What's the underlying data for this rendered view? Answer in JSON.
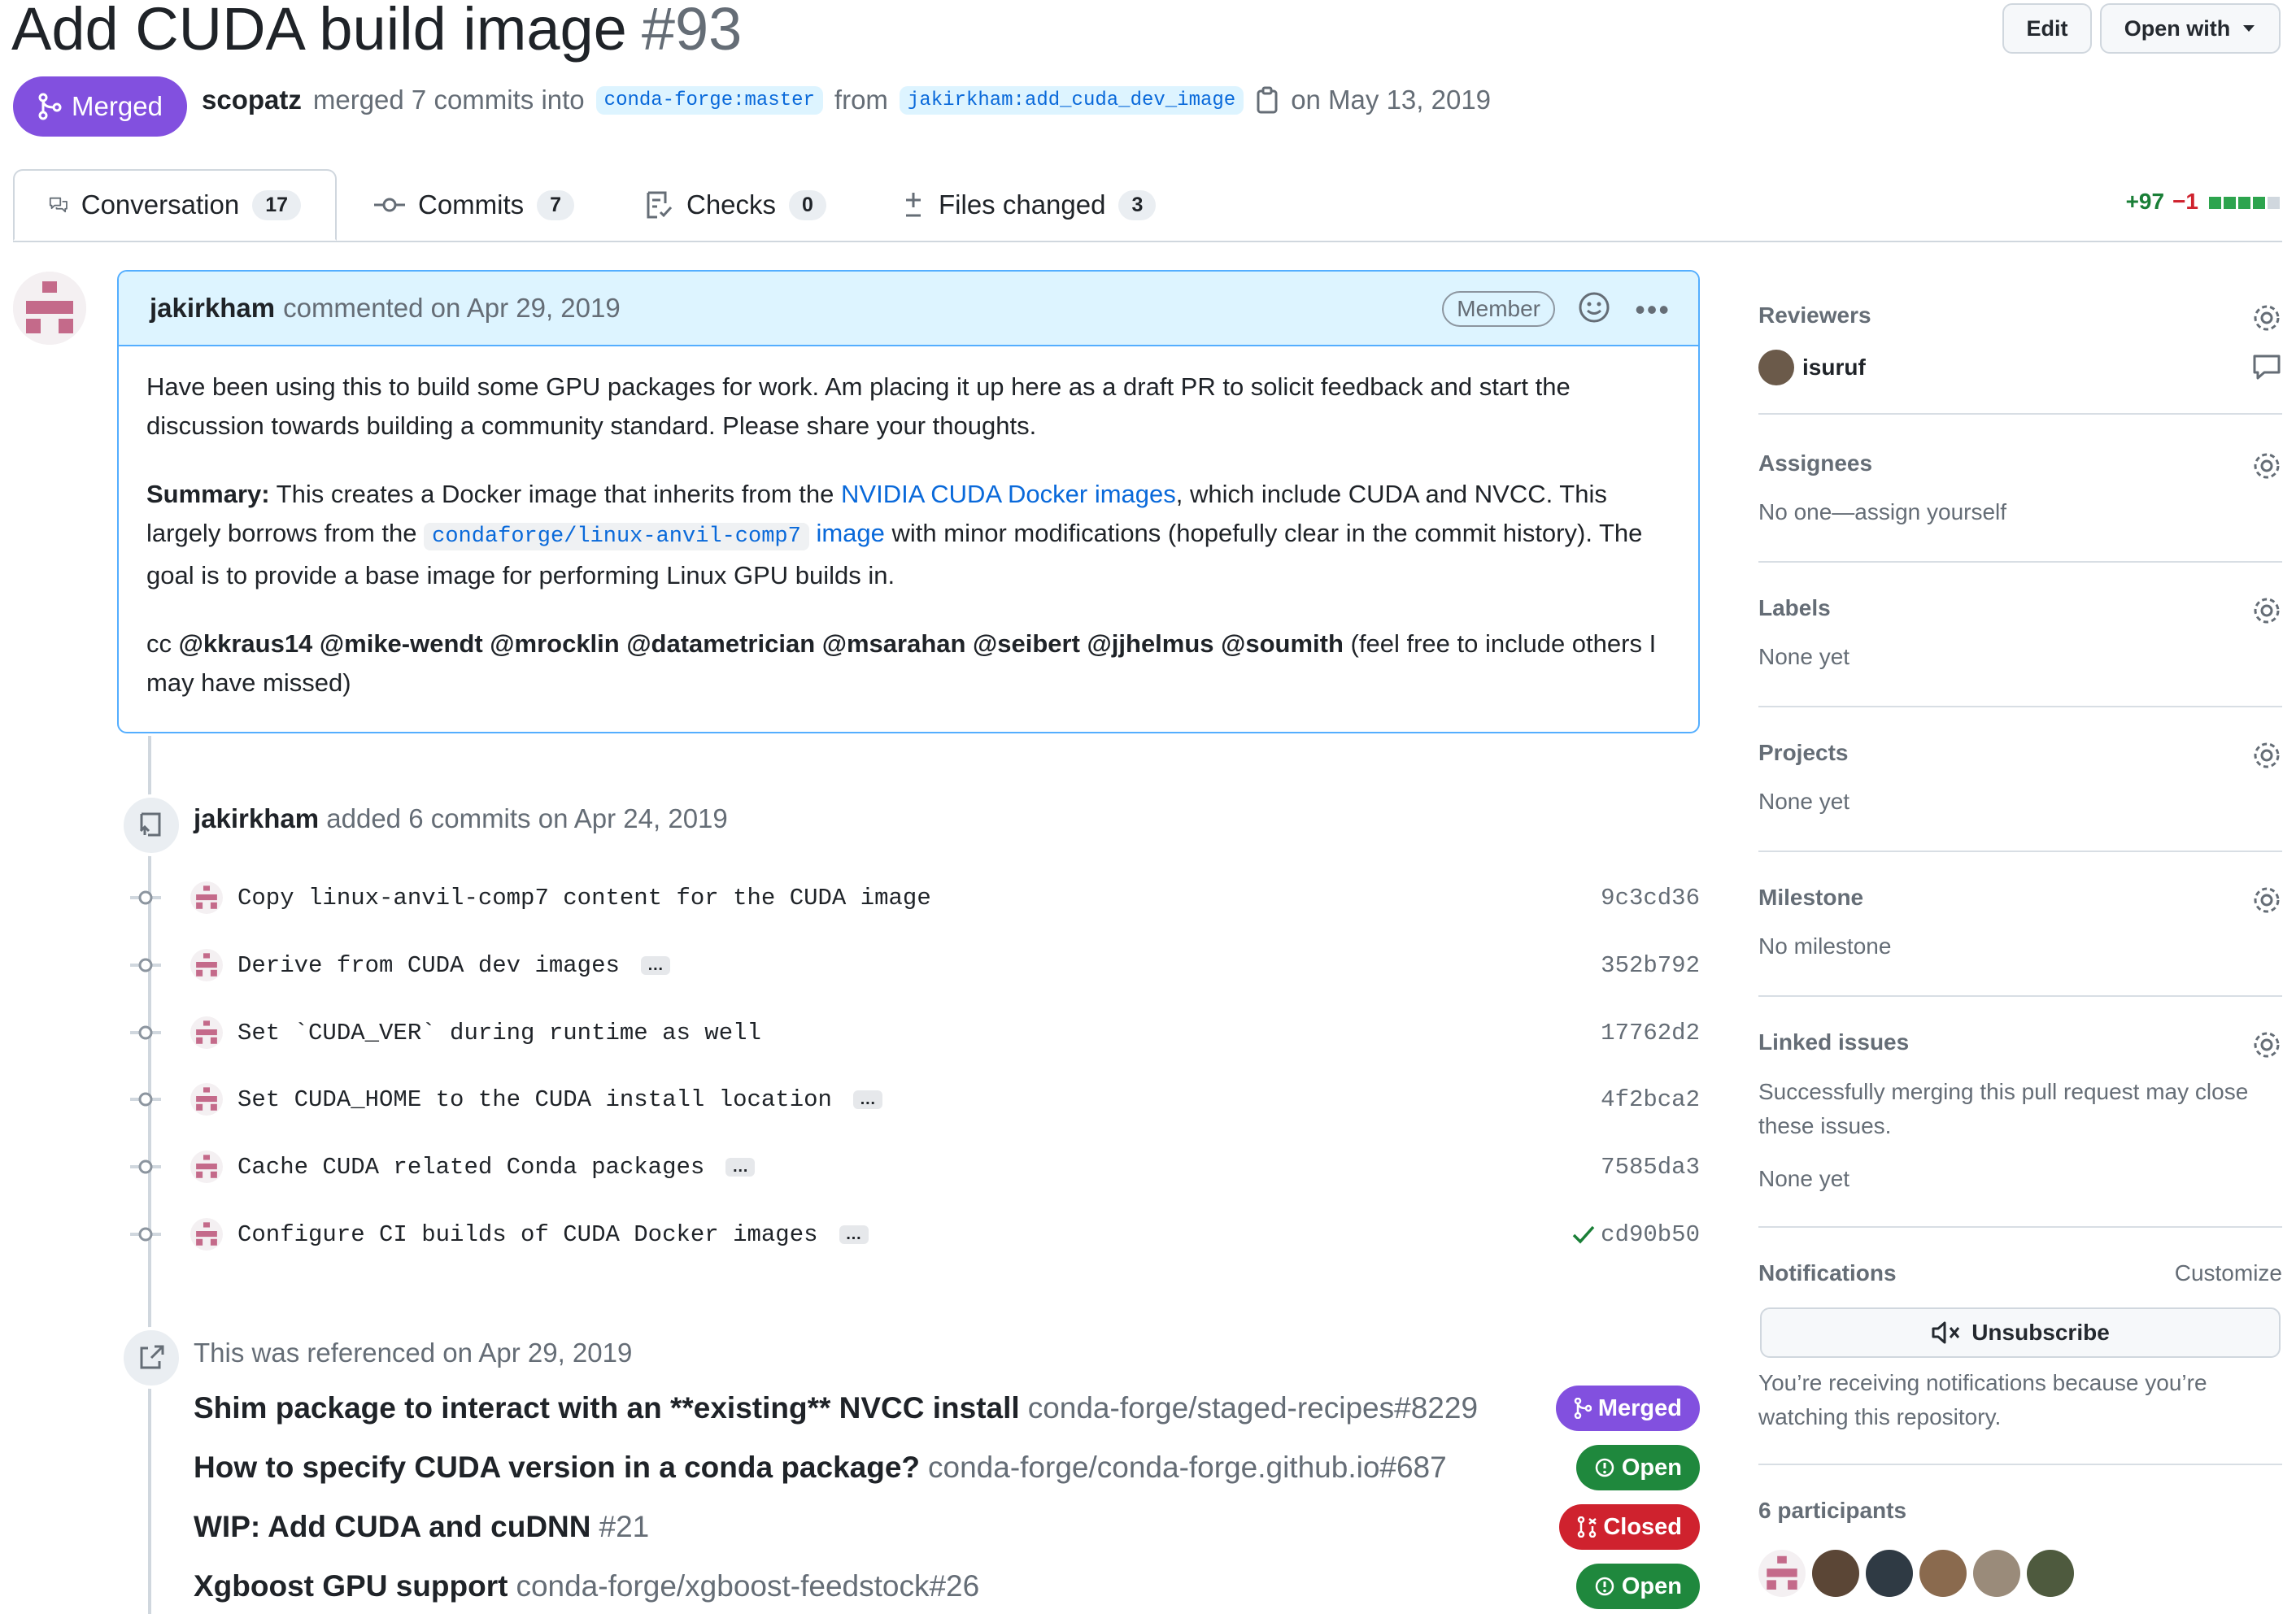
{
  "pr": {
    "title": "Add CUDA build image",
    "number": "#93",
    "state": "Merged",
    "author": "scopatz",
    "merge_text": "merged 7 commits into",
    "base_branch": "conda-forge:master",
    "from_text": "from",
    "head_branch": "jakirkham:add_cuda_dev_image",
    "date_text": "on May 13, 2019"
  },
  "header_buttons": {
    "edit": "Edit",
    "open_with": "Open with"
  },
  "tabs": [
    {
      "label": "Conversation",
      "count": "17"
    },
    {
      "label": "Commits",
      "count": "7"
    },
    {
      "label": "Checks",
      "count": "0"
    },
    {
      "label": "Files changed",
      "count": "3"
    }
  ],
  "diffstat": {
    "additions": "+97",
    "deletions": "−1"
  },
  "comment": {
    "author": "jakirkham",
    "meta": "commented on Apr 29, 2019",
    "badge": "Member",
    "p1": "Have been using this to build some GPU packages for work. Am placing it up here as a draft PR to solicit feedback and start the discussion towards building a community standard. Please share your thoughts.",
    "summary_label": "Summary:",
    "summary_a": "This creates a Docker image that inherits from the",
    "summary_link": "NVIDIA CUDA Docker images",
    "summary_b": ", which include CUDA and NVCC. This largely borrows from the",
    "summary_code": "condaforge/linux-anvil-comp7",
    "summary_link2": "image",
    "summary_c": "with minor modifications (hopefully clear in the commit history). The goal is to provide a base image for performing Linux GPU builds in.",
    "cc_prefix": "cc",
    "cc_mentions": "@kkraus14 @mike-wendt @mrocklin @datametrician @msarahan @seibert @jjhelmus @soumith",
    "cc_suffix": "(feel free to include others I may have missed)"
  },
  "commits_event": {
    "author": "jakirkham",
    "text": "added 6 commits on Apr 24, 2019"
  },
  "commits": [
    {
      "message": "Copy linux-anvil-comp7 content for the CUDA image",
      "sha": "9c3cd36",
      "more": false,
      "check": false
    },
    {
      "message": "Derive from CUDA dev images",
      "sha": "352b792",
      "more": true,
      "check": false
    },
    {
      "message": "Set `CUDA_VER` during runtime as well",
      "sha": "17762d2",
      "more": false,
      "check": false
    },
    {
      "message": "Set CUDA_HOME to the CUDA install location",
      "sha": "4f2bca2",
      "more": true,
      "check": false
    },
    {
      "message": "Cache CUDA related Conda packages",
      "sha": "7585da3",
      "more": true,
      "check": false
    },
    {
      "message": "Configure CI builds of CUDA Docker images",
      "sha": "cd90b50",
      "more": true,
      "check": true
    }
  ],
  "ref_event": {
    "text": "This was referenced on Apr 29, 2019"
  },
  "references": [
    {
      "title": "Shim package to interact with an **existing** NVCC install",
      "repo": "conda-forge/staged-recipes#8229",
      "state": "Merged",
      "color": "#8250df"
    },
    {
      "title": "How to specify CUDA version in a conda package?",
      "repo": "conda-forge/conda-forge.github.io#687",
      "state": "Open",
      "color": "#1f883d"
    },
    {
      "title": "WIP: Add CUDA and cuDNN",
      "repo": "#21",
      "state": "Closed",
      "color": "#cf222e"
    },
    {
      "title": "Xgboost GPU support",
      "repo": "conda-forge/xgboost-feedstock#26",
      "state": "Open",
      "color": "#1f883d"
    }
  ],
  "sidebar": {
    "reviewers": {
      "heading": "Reviewers",
      "name": "isuruf"
    },
    "assignees": {
      "heading": "Assignees",
      "value": "No one—assign yourself"
    },
    "labels": {
      "heading": "Labels",
      "value": "None yet"
    },
    "projects": {
      "heading": "Projects",
      "value": "None yet"
    },
    "milestone": {
      "heading": "Milestone",
      "value": "No milestone"
    },
    "linked": {
      "heading": "Linked issues",
      "desc": "Successfully merging this pull request may close these issues.",
      "value": "None yet"
    },
    "notifications": {
      "heading": "Notifications",
      "customize": "Customize",
      "button": "Unsubscribe",
      "desc": "You’re receiving notifications because you’re watching this repository."
    },
    "participants": {
      "heading": "6 participants"
    }
  }
}
